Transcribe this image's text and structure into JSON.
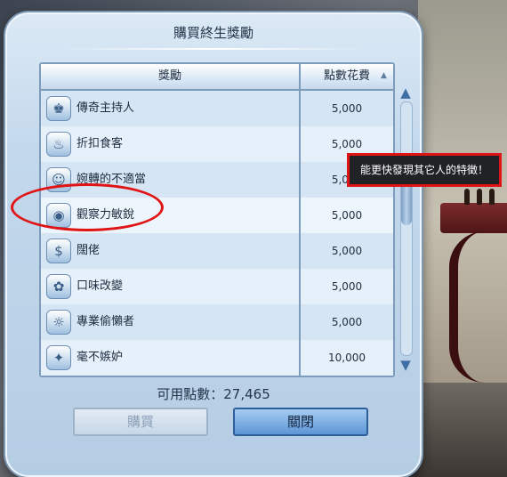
{
  "dialog": {
    "title": "購買終生獎勵",
    "columns": {
      "reward": "獎勵",
      "cost": "點數花費"
    },
    "rows": [
      {
        "name": "傳奇主持人",
        "cost": "5,000",
        "icon": "host-icon",
        "glyph": "♚"
      },
      {
        "name": "折扣食客",
        "cost": "5,000",
        "icon": "diner-icon",
        "glyph": "♨"
      },
      {
        "name": "婉轉的不適當",
        "cost": "5,000",
        "icon": "businessman-icon",
        "glyph": "☺"
      },
      {
        "name": "觀察力敏銳",
        "cost": "5,000",
        "icon": "observant-icon",
        "glyph": "◉"
      },
      {
        "name": "闊佬",
        "cost": "5,000",
        "icon": "rich-icon",
        "glyph": "$"
      },
      {
        "name": "口味改變",
        "cost": "5,000",
        "icon": "taste-icon",
        "glyph": "✿"
      },
      {
        "name": "專業偷懶者",
        "cost": "5,000",
        "icon": "slacker-icon",
        "glyph": "☼"
      },
      {
        "name": "毫不嫉妒",
        "cost": "10,000",
        "icon": "unjealous-icon",
        "glyph": "✦"
      }
    ],
    "points_label": "可用點數：27,465",
    "buy_label": "購買",
    "close_label": "關閉"
  },
  "tooltip": {
    "text": "能更快發現其它人的特徵！"
  },
  "colors": {
    "annotation": "#e01414",
    "accent": "#5c95d6"
  }
}
